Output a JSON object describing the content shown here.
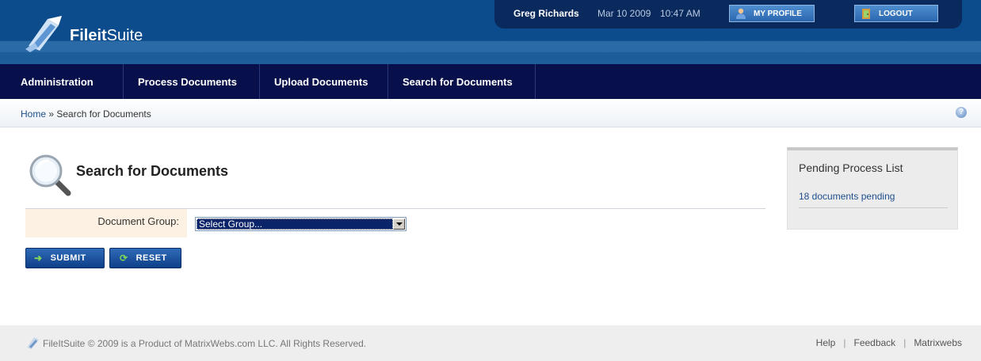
{
  "header": {
    "logo_bold": "Fileit",
    "logo_light": "Suite",
    "user_name": "Greg Richards",
    "date": "Mar 10 2009",
    "time": "10:47 AM",
    "my_profile_label": "MY PROFILE",
    "logout_label": "LOGOUT"
  },
  "nav": {
    "items": [
      {
        "label": "Administration"
      },
      {
        "label": "Process Documents"
      },
      {
        "label": "Upload Documents"
      },
      {
        "label": "Search for Documents"
      }
    ]
  },
  "breadcrumb": {
    "home": "Home",
    "separator": " » ",
    "current": "Search for Documents",
    "help_icon": "?"
  },
  "main": {
    "title": "Search for Documents",
    "form": {
      "document_group_label": "Document Group:",
      "document_group_value": "Select Group..."
    },
    "submit_label": "SUBMIT",
    "reset_label": "RESET"
  },
  "pending": {
    "title": "Pending Process List",
    "link": "18 documents pending"
  },
  "footer": {
    "copyright": "FileItSuite © 2009 is a Product of MatrixWebs.com LLC. All Rights Reserved.",
    "links": [
      {
        "label": "Help"
      },
      {
        "label": "Feedback"
      },
      {
        "label": "Matrixwebs"
      }
    ],
    "separator": "|"
  },
  "colors": {
    "header_blue": "#0c4c8c",
    "nav_navy": "#07104a",
    "link_blue": "#1d4f8f",
    "button_blue": "#0e3f88"
  },
  "icons": {
    "logo": "paper-plane-icon",
    "profile": "user-icon",
    "logout": "door-icon",
    "search": "magnifier-icon",
    "help": "help-icon",
    "submit": "arrow-right-icon",
    "reset": "refresh-icon"
  }
}
